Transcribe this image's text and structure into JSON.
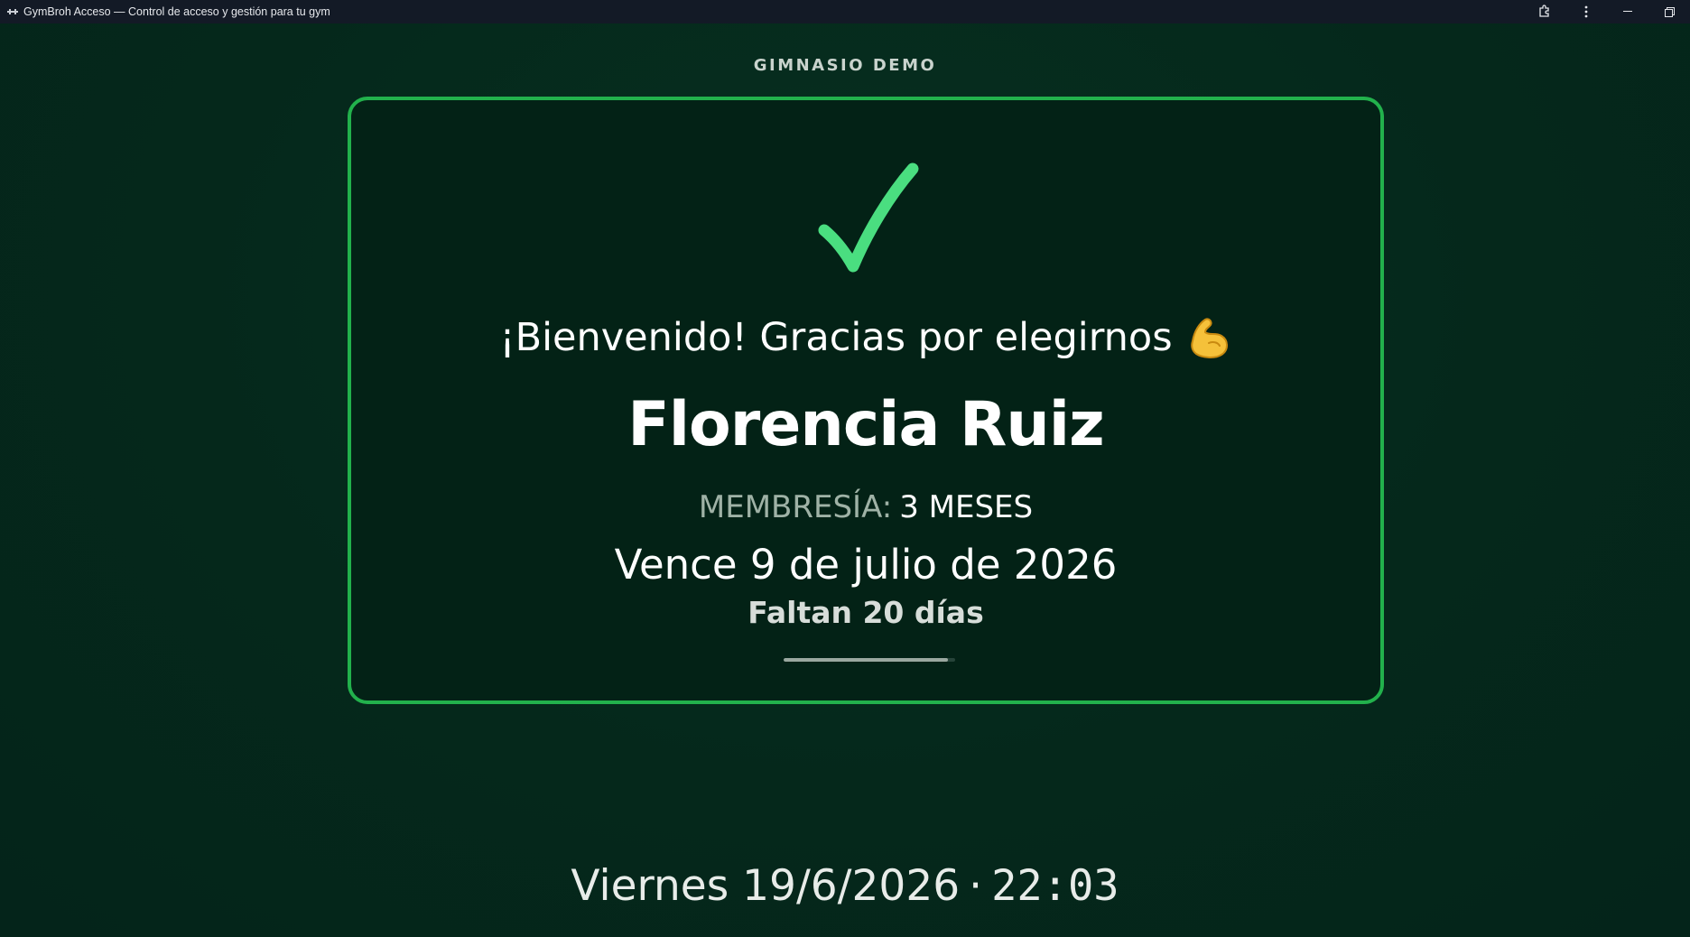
{
  "window": {
    "title": "GymBroh Acceso — Control de acceso y gestión para tu gym",
    "icons": [
      "app-icon",
      "extensions-icon",
      "more-options-icon",
      "minimize-icon",
      "restore-icon"
    ]
  },
  "gym": {
    "name": "GIMNASIO DEMO"
  },
  "access": {
    "status_icon": "checkmark-icon",
    "status_color": "#4ade80",
    "border_color": "#22b14c",
    "welcome_text": "¡Bienvenido! Gracias por elegirnos",
    "welcome_icon": "flexed-biceps-icon",
    "member_name": "Florencia Ruiz",
    "membership_label": "MEMBRESÍA:",
    "membership_value": "3 MESES",
    "expires_text": "Vence 9 de julio de 2026",
    "remaining_text": "Faltan 20 días",
    "progress_fraction": 0.96
  },
  "footer": {
    "date_text": "Viernes 19/6/2026",
    "separator": "·",
    "time_text": "22:03"
  }
}
